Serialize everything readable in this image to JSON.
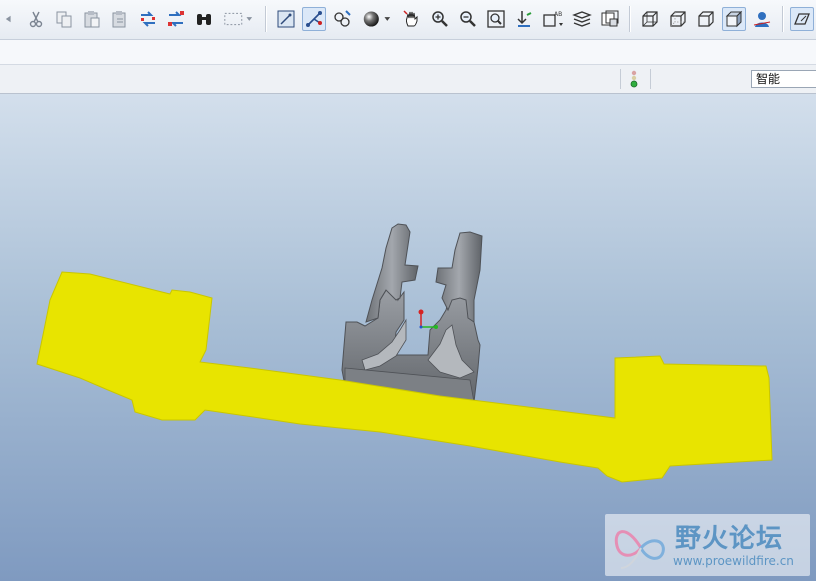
{
  "toolbar": {
    "groups": [
      {
        "name": "edit",
        "items": [
          "undo-icon",
          "cut-icon",
          "copy-icon",
          "paste-icon",
          "paste-special-icon",
          "regenerate-icon",
          "regenerate-manager-icon",
          "find-icon",
          "select-box-icon"
        ]
      },
      {
        "name": "view",
        "items": [
          "datum-display-icon",
          "spin-center-icon",
          "appearance-icon",
          "shade-icon",
          "pan-icon",
          "zoom-in-icon",
          "zoom-out-icon",
          "refit-icon",
          "reorient-icon",
          "saved-views-icon",
          "layers-icon",
          "view-manager-icon"
        ]
      },
      {
        "name": "display-style",
        "items": [
          "wireframe-icon",
          "hidden-line-icon",
          "no-hidden-icon",
          "shaded-icon",
          "enhanced-realism-icon",
          "plane-display-icon"
        ]
      }
    ],
    "active": [
      "spin-center-icon",
      "shaded-icon",
      "plane-display-icon"
    ]
  },
  "status_bar": {
    "filter_value": "智能"
  },
  "colors": {
    "part_yellow": "#e8e400",
    "part_gray": "#8c8f94",
    "viewport_top": "#d3dfec",
    "viewport_bottom": "#7f9ac0"
  },
  "watermark": {
    "title": "野火论坛",
    "url": "www.proewildfire.cn"
  }
}
